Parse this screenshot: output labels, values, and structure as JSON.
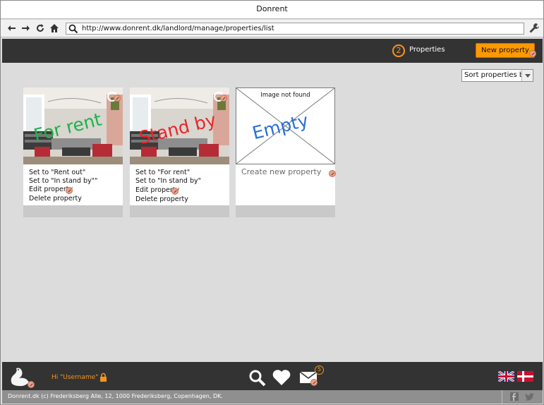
{
  "window": {
    "title": "Donrent"
  },
  "addressbar": {
    "url": "http://www.donrent.dk/landlord/manage/properties/list"
  },
  "topnav": {
    "properties_count": "2",
    "properties_label": "Properties",
    "new_property_label": "New property",
    "accent_color": "#ff9900"
  },
  "sort": {
    "label": "Sort properties by"
  },
  "cards": [
    {
      "stamp": "For rent",
      "stamp_color": "#1bb34a",
      "menu": [
        "Set to \"Rent out\"",
        "Set to \"In stand by\"\"",
        "Edit property",
        "Delete property"
      ]
    },
    {
      "stamp": "Stand by",
      "stamp_color": "#e8262a",
      "menu": [
        "Set to \"For rent\"",
        "Set to \"In stand by\"",
        "Edit property",
        "Delete property"
      ]
    }
  ],
  "empty_card": {
    "image_text": "Image not found",
    "stamp": "Empty",
    "stamp_color": "#2b6fd6",
    "create_label": "Create new property"
  },
  "bottombar": {
    "greeting": "Hi \"Username\"",
    "mail_badge": "5"
  },
  "footer": {
    "text": "Donrent.dk (c) Frederiksberg Alle, 12, 1000 Frederiksberg, Copenhagen, DK."
  }
}
